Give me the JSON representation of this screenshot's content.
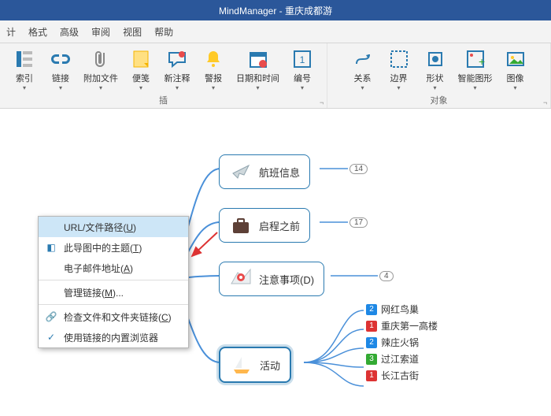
{
  "app": {
    "title": "MindManager - 重庆成都游"
  },
  "menu": {
    "items": [
      "计",
      "格式",
      "高级",
      "审阅",
      "视图",
      "帮助"
    ]
  },
  "ribbon": {
    "group_insert": {
      "label": "插",
      "buttons": [
        {
          "label": "索引",
          "icon": "index"
        },
        {
          "label": "链接",
          "icon": "link"
        },
        {
          "label": "附加文件",
          "icon": "attach"
        },
        {
          "label": "便笺",
          "icon": "note"
        },
        {
          "label": "新注释",
          "icon": "comment"
        },
        {
          "label": "警报",
          "icon": "bell"
        },
        {
          "label": "日期和时间",
          "icon": "calendar"
        },
        {
          "label": "编号",
          "icon": "number"
        }
      ]
    },
    "group_objects": {
      "label": "对象",
      "buttons": [
        {
          "label": "关系",
          "icon": "relation"
        },
        {
          "label": "边界",
          "icon": "boundary"
        },
        {
          "label": "形状",
          "icon": "shape"
        },
        {
          "label": "智能图形",
          "icon": "smartshape"
        },
        {
          "label": "图像",
          "icon": "image"
        }
      ]
    }
  },
  "dropdown": {
    "items": [
      {
        "icon": "",
        "text": "URL/文件路径(",
        "u": "U",
        "tail": ")",
        "hover": true
      },
      {
        "icon": "topic",
        "text": "此导图中的主题(",
        "u": "T",
        "tail": ")"
      },
      {
        "icon": "",
        "text": "电子邮件地址(",
        "u": "A",
        "tail": ")"
      },
      {
        "sep": true
      },
      {
        "icon": "",
        "text": "管理链接(",
        "u": "M",
        "tail": ")..."
      },
      {
        "sep": true
      },
      {
        "icon": "link",
        "text": "检查文件和文件夹链接(",
        "u": "C",
        "tail": ")"
      },
      {
        "icon": "check",
        "text": "使用链接的内置浏览器"
      }
    ]
  },
  "map": {
    "main": "重庆成都游",
    "nodes": {
      "flight": "航班信息",
      "before": "启程之前",
      "notes": "注意事项(D)",
      "activity": "活动"
    },
    "badges": {
      "flight": "14",
      "before": "17",
      "notes": "4"
    },
    "subs": [
      {
        "c": "b",
        "n": "2",
        "t": "网红鸟巢"
      },
      {
        "c": "r",
        "n": "1",
        "t": "重庆第一高楼"
      },
      {
        "c": "b",
        "n": "2",
        "t": "辣庄火锅"
      },
      {
        "c": "g",
        "n": "3",
        "t": "过江索道"
      },
      {
        "c": "r",
        "n": "1",
        "t": "长江古街"
      }
    ]
  }
}
